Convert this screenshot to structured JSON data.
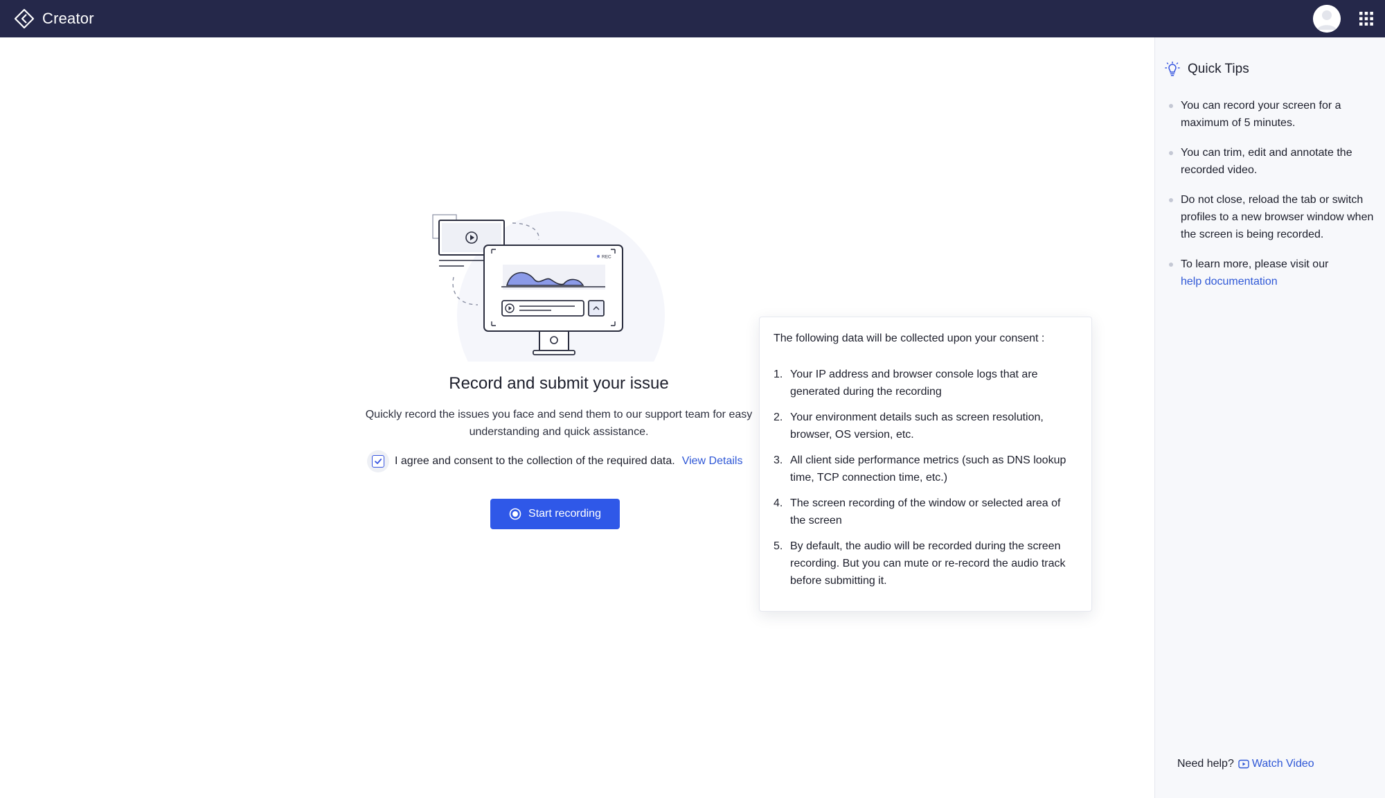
{
  "app": {
    "name": "Creator"
  },
  "main": {
    "title": "Record and submit your issue",
    "description": "Quickly record the issues you face and send them to our support team for easy understanding and quick assistance.",
    "consent_text": "I agree and consent to the collection of the required data.",
    "consent_checked": true,
    "view_details_label": "View Details",
    "start_button_label": "Start recording",
    "illustration_rec_label": "REC"
  },
  "popover": {
    "heading": "The following data will be collected upon your consent :",
    "items": [
      {
        "num": "1.",
        "text": "Your IP address and browser console logs that are generated during the recording"
      },
      {
        "num": "2.",
        "text": "Your environment details such as screen resolution, browser, OS version, etc."
      },
      {
        "num": "3.",
        "text": "All client side performance metrics (such as DNS lookup time, TCP connection time, etc.)"
      },
      {
        "num": "4.",
        "text": "The screen recording of the window or selected area of the screen"
      },
      {
        "num": "5.",
        "text": "By default, the audio will be recorded during the screen recording. But you can mute or re-record the audio track before submitting it."
      }
    ]
  },
  "sidebar": {
    "title": "Quick Tips",
    "tips": [
      "You can record your screen for a maximum of 5 minutes.",
      "You can trim, edit and annotate the recorded video.",
      "Do not close, reload the tab or switch profiles to a new browser window when the screen is being recorded.",
      "To learn more, please visit our"
    ],
    "help_link_label": "help documentation",
    "need_help_label": "Need help?",
    "watch_video_label": "Watch Video"
  },
  "colors": {
    "topbar": "#25284a",
    "accent": "#2f58e8",
    "link": "#2e57d6",
    "sidebar_bg": "#f7f8fb"
  },
  "icons": [
    "creator-logo-icon",
    "avatar",
    "apps-grid-icon",
    "checkbox-check-icon",
    "record-icon",
    "lightbulb-icon",
    "play-video-icon"
  ]
}
